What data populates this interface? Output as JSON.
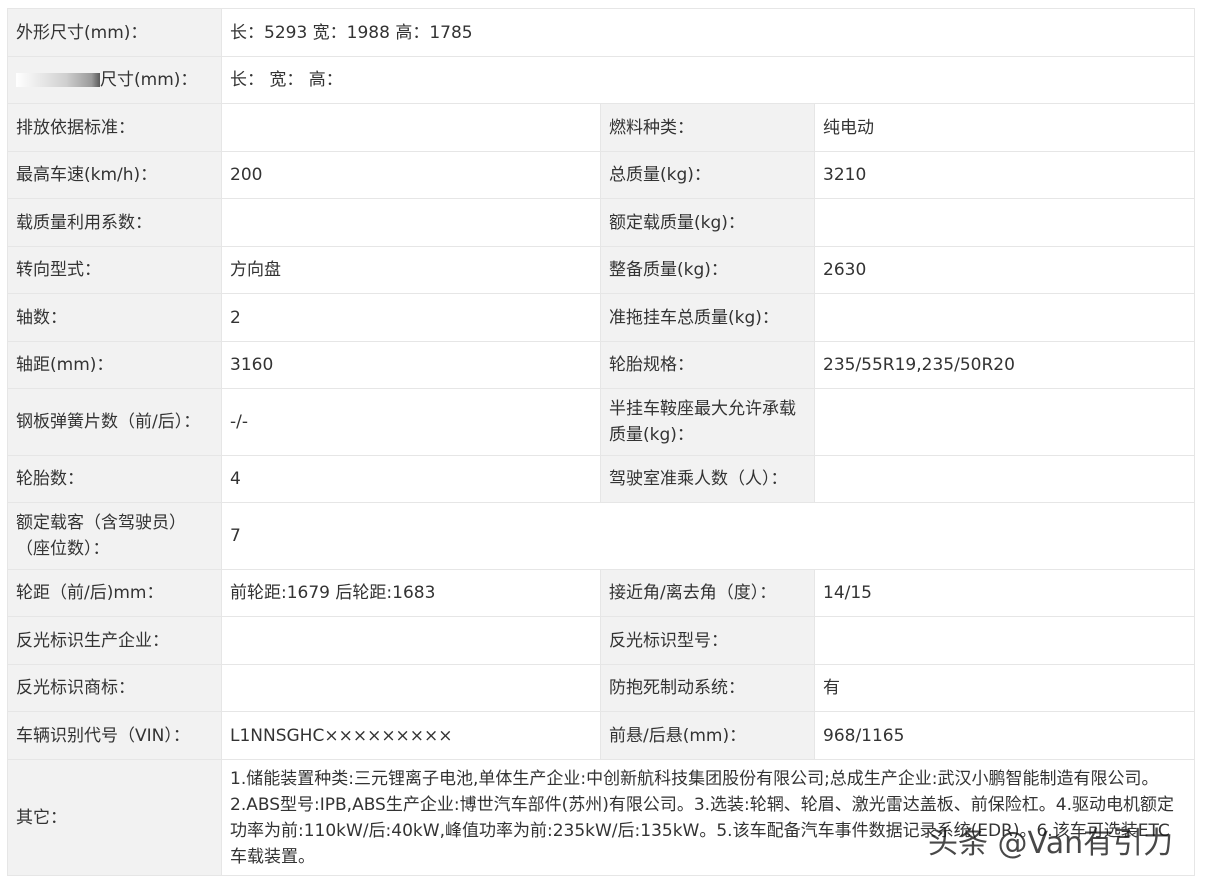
{
  "dims": {
    "outer_label": "外形尺寸(mm)：",
    "outer_value": "长：5293 宽：1988 高：1785",
    "cargo_label": "尺寸(mm)：",
    "cargo_value": "长： 宽： 高："
  },
  "rows": [
    {
      "l1": "排放依据标准：",
      "v1": "",
      "l2": "燃料种类：",
      "v2": "纯电动"
    },
    {
      "l1": "最高车速(km/h)：",
      "v1": "200",
      "l2": "总质量(kg)：",
      "v2": "3210"
    },
    {
      "l1": "载质量利用系数：",
      "v1": "",
      "l2": "额定载质量(kg)：",
      "v2": ""
    },
    {
      "l1": "转向型式：",
      "v1": "方向盘",
      "l2": "整备质量(kg)：",
      "v2": "2630"
    },
    {
      "l1": "轴数：",
      "v1": "2",
      "l2": "准拖挂车总质量(kg)：",
      "v2": ""
    },
    {
      "l1": "轴距(mm)：",
      "v1": "3160",
      "l2": "轮胎规格：",
      "v2": "235/55R19,235/50R20"
    },
    {
      "l1": "钢板弹簧片数（前/后）：",
      "v1": "-/-",
      "l2_a": "半挂车鞍座最大允许承载",
      "l2_b": "质量(kg)：",
      "v2": ""
    },
    {
      "l1": "轮胎数：",
      "v1": "4",
      "l2": "驾驶室准乘人数（人）：",
      "v2": ""
    },
    {
      "l1_a": "额定载客（含驾驶员）",
      "l1_b": "（座位数）：",
      "v1": "7"
    },
    {
      "l1": "轮距（前/后)mm：",
      "v1": "前轮距:1679 后轮距:1683",
      "l2": "接近角/离去角（度）：",
      "v2": "14/15"
    },
    {
      "l1": "反光标识生产企业：",
      "v1": "",
      "l2": "反光标识型号：",
      "v2": ""
    },
    {
      "l1": "反光标识商标：",
      "v1": "",
      "l2": "防抱死制动系统：",
      "v2": "有"
    },
    {
      "l1": "车辆识别代号（VIN）：",
      "v1": "L1NNSGHC×××××××××",
      "l2": "前悬/后悬(mm)：",
      "v2": "968/1165"
    }
  ],
  "other": {
    "label": "其它：",
    "line1": "1.储能装置种类:三元锂离子电池,单体生产企业:中创新航科技集团股份有限公司;总成生产企业:武汉小鹏智能制造有限公司。",
    "line2": "2.ABS型号:IPB,ABS生产企业:博世汽车部件(苏州)有限公司。3.选装:轮辋、轮眉、激光雷达盖板、前保险杠。4.驱动电机额定",
    "line3": "功率为前:110kW/后:40kW,峰值功率为前:235kW/后:135kW。5.该车配备汽车事件数据记录系统(EDR)。6.该车可选装ETC",
    "line4": "车载装置。"
  },
  "watermark": "头条 @Van有引力"
}
